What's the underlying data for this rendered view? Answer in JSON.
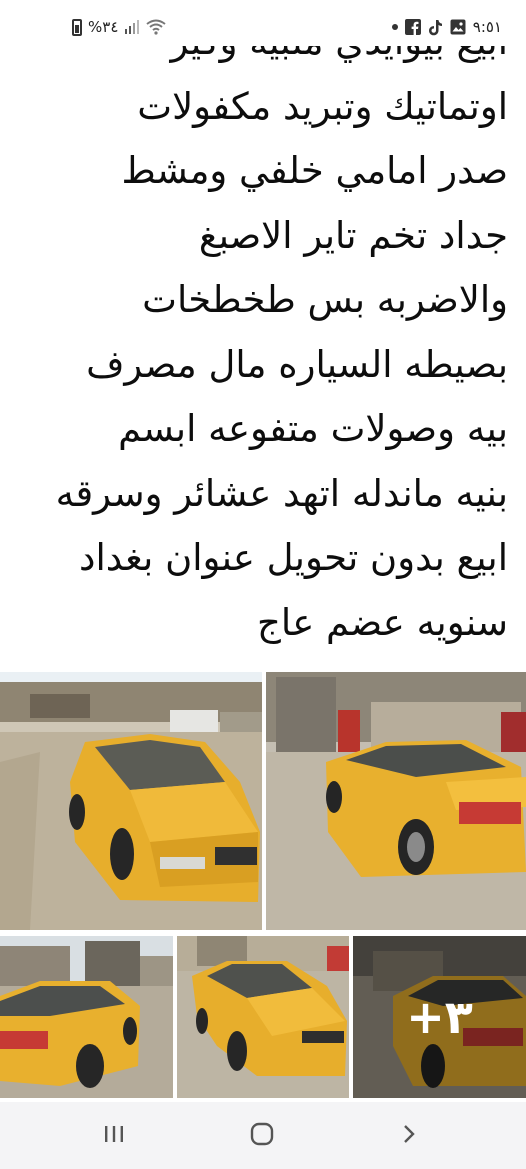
{
  "status_bar": {
    "time": "٩:٥١",
    "battery_percent": "%٣٤",
    "notification_icons": [
      "facebook-icon",
      "tiktok-icon",
      "gallery-icon"
    ],
    "connectivity_icons": [
      "signal-icon",
      "wifi-icon",
      "battery-icon"
    ]
  },
  "post": {
    "text_lines": [
      "ابيع بيوايدي ملبيه وكير",
      "اوتماتيك وتبريد مكفولات",
      "صدر امامي خلفي ومشط",
      "جداد  تخم تاير الاصبغ",
      "والاضربه بس طخطخات",
      "بصيطه السياره مال مصرف",
      "بيه وصولات متفوعه ابسم",
      "بنيه ماندله اتهد عشائر وسرقه",
      "ابيع بدون تحويل عنوان بغداد",
      "سنويه عضم عاج"
    ]
  },
  "photos": {
    "items": [
      {
        "name": "yellow-taxi-front-view"
      },
      {
        "name": "yellow-taxi-rear-side-view"
      },
      {
        "name": "yellow-taxi-rear-view"
      },
      {
        "name": "yellow-taxi-front-angle"
      },
      {
        "name": "yellow-taxi-rear-angle"
      }
    ],
    "more_count": "+٣"
  },
  "nav_bar": {
    "buttons": [
      "recent-apps-icon",
      "home-icon",
      "back-icon"
    ]
  },
  "colors": {
    "taxi_yellow": "#e8b02e",
    "nav_background": "#f4f4f6",
    "text": "#0d0d0d"
  }
}
